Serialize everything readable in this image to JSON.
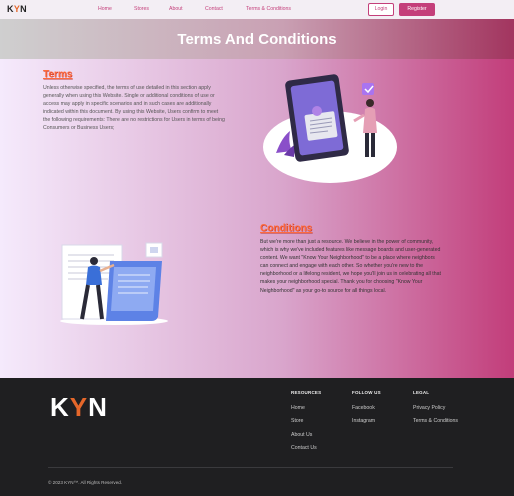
{
  "brand": {
    "k": "K",
    "y": "Y",
    "n": "N"
  },
  "nav": {
    "links": [
      "Home",
      "Stores",
      "About",
      "Contact",
      "Terms & Conditions"
    ],
    "login": "Login",
    "register": "Register"
  },
  "hero": {
    "title": "Terms And Conditions"
  },
  "terms": {
    "title": "Terms",
    "lines": [
      "Unless otherwise specified, the terms of use detailed in this section apply",
      "generally when using this Website. Single or additional conditions of use or",
      "access may apply in specific scenarios and in such cases are additionally",
      "indicated within this document. By using this Website, Users confirm to meet",
      "the following requirements: There are no restrictions for Users in terms of being",
      "Consumers or Business Users;"
    ]
  },
  "conditions": {
    "title": "Conditions",
    "lines": [
      "But we're more than just a resource. We believe in the power of community,",
      "which is why we've included features like message boards and user-generated",
      "content. We want \"Know Your Neighborhood\" to be a place where neighbors",
      "can connect and engage with each other. So whether you're new to the",
      "neighborhood or a lifelong resident, we hope you'll join us in celebrating all that",
      "makes your neighborhood special. Thank you for choosing \"Know Your",
      "Neighborhood\" as your go-to source for all things local."
    ]
  },
  "footer": {
    "resources": {
      "heading": "RESOURCES",
      "links": [
        "Home",
        "Store",
        "About Us",
        "Contact Us"
      ]
    },
    "follow": {
      "heading": "FOLLOW US",
      "links": [
        "Facebook",
        "Instagram"
      ]
    },
    "legal": {
      "heading": "LEGAL",
      "links": [
        "Privacy Policy",
        "Terms & Conditions"
      ]
    },
    "copyright": "© 2023 KYN™. All Rights Reserved."
  },
  "colors": {
    "accent": "#c43f7a",
    "orange": "#e5672a",
    "footer_bg": "#1f1f21"
  }
}
